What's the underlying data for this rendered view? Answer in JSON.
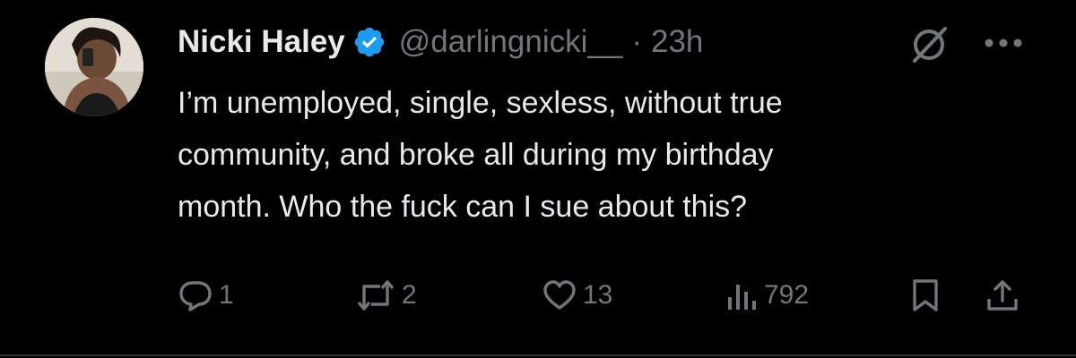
{
  "user": {
    "name": "Nicki Haley",
    "handle": "@darlingnicki__",
    "separator": "·",
    "time": "23h",
    "verified": true
  },
  "tweet": {
    "lines": [
      "I’m unemployed, single, sexless, without true",
      "community, and broke all during my birthday",
      "month. Who the fuck can I sue about this?"
    ]
  },
  "actions": {
    "replies": "1",
    "reposts": "2",
    "likes": "13",
    "views": "792"
  },
  "icons": {
    "verified": "verified-badge-icon",
    "grok": "grok-icon",
    "more": "more-icon",
    "reply": "reply-icon",
    "repost": "repost-icon",
    "like": "heart-icon",
    "views": "views-icon",
    "bookmark": "bookmark-icon",
    "share": "share-icon"
  },
  "colors": {
    "background": "#000000",
    "text": "#e7e9ea",
    "muted": "#71767b",
    "verified": "#1d9bf0"
  }
}
